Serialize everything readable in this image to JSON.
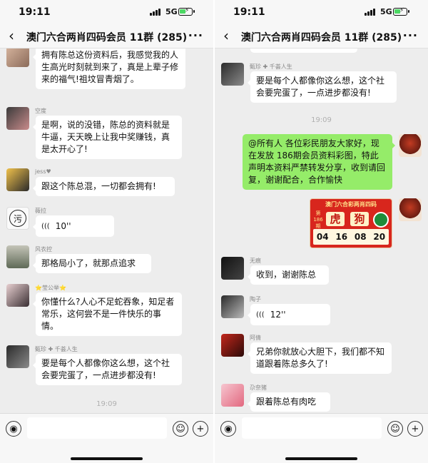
{
  "status": {
    "time": "19:11",
    "network": "5G"
  },
  "chat_title": "澳门六合两肖四码会员 11群 (285)",
  "left_panel": {
    "messages": [
      {
        "nick": "",
        "text": "拥有陈总这份资料后，我感觉我的人生高光时刻就到来了，真是上辈子修来的福气!祖坟冒青烟了。"
      },
      {
        "nick": "空度",
        "text": "是啊，说的没错，陈总的资料就是牛逼，天天晚上让我中奖赚钱，真是太开心了!"
      },
      {
        "nick": "jess♥",
        "text": "跟这个陈总混，一切都会拥有!"
      },
      {
        "nick": "薇拉",
        "voice": "10''"
      },
      {
        "nick": "风衣控",
        "text": "那格局小了，就那点追求"
      },
      {
        "nick": "⭐莹公举⭐",
        "text": "你懂什么?人心不足蛇吞象，知足者常乐，这何尝不是一件快乐的事情。"
      },
      {
        "nick": "甄珍 ✚ 千荟人生",
        "text": "要是每个人都像你这么想，这个社会要完蛋了，一点进步都没有!"
      }
    ],
    "timestamp": "19:09"
  },
  "right_panel": {
    "top_nick": "甄珍 ✚ 千荟人生",
    "top_text": "要是每个人都像你这么想，这个社会要完蛋了，一点进步都没有!",
    "timestamp": "19:09",
    "announcement": "@所有人 各位彩民朋友大家好，现在发放 186期会员资料彩图，特此声明本资料严禁转发分享，收到请回复，谢谢配合，合作愉快",
    "poster": {
      "heading": "澳门六合彩两肖四码",
      "label_period": "第",
      "label_num": "186",
      "label_qi": "期",
      "zodiac_1": "虎",
      "zodiac_2": "狗",
      "numbers": [
        "04",
        "16",
        "08",
        "20"
      ]
    },
    "messages": [
      {
        "nick": "无痕",
        "text": "收到，谢谢陈总"
      },
      {
        "nick": "陶子",
        "voice": "12''"
      },
      {
        "nick": "阿倩",
        "text": "兄弟你就放心大胆下，我们都不知道跟着陈总多久了!"
      },
      {
        "nick": "尕奈猪",
        "text": "跟着陈总有肉吃"
      }
    ]
  },
  "input_bar": {
    "emoji_glyph": "☺",
    "add_glyph": "+",
    "voice_glyph": "◉"
  },
  "colors": {
    "chat_bg": "#ededed",
    "sent_bubble": "#95ec69",
    "received_bubble": "#ffffff"
  }
}
